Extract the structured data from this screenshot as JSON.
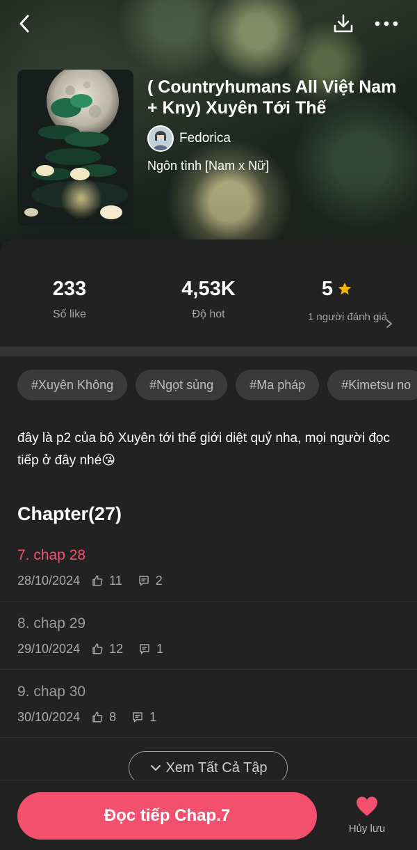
{
  "header": {
    "title": "( Countryhumans All Việt Nam + Kny) Xuyên Tới Thế",
    "author": "Fedorica",
    "genre": "Ngôn tình [Nam x Nữ]"
  },
  "stats": {
    "likes": {
      "value": "233",
      "label": "Số like"
    },
    "hot": {
      "value": "4,53K",
      "label": "Độ hot"
    },
    "rating": {
      "value": "5",
      "label": "1 người đánh giá"
    }
  },
  "tags": [
    "#Xuyên Không",
    "#Ngọt sủng",
    "#Ma pháp",
    "#Kimetsu no"
  ],
  "description": "đây là p2 của bộ Xuyên tới thế giới diệt quỷ nha, mọi người đọc tiếp ở đây nhé😘",
  "chapters": {
    "heading": "Chapter(27)",
    "items": [
      {
        "title": "7. chap 28",
        "date": "28/10/2024",
        "likes": "11",
        "comments": "2"
      },
      {
        "title": "8. chap 29",
        "date": "29/10/2024",
        "likes": "12",
        "comments": "1"
      },
      {
        "title": "9. chap 30",
        "date": "30/10/2024",
        "likes": "8",
        "comments": "1"
      }
    ],
    "see_all": "Xem Tất Cả Tập"
  },
  "bottom": {
    "read_button": "Đọc tiếp Chap.7",
    "save_label": "Hủy lưu"
  },
  "colors": {
    "accent": "#f2506c",
    "background": "#222222",
    "star": "#f5b400"
  },
  "icons": {
    "back": "chevron-left-icon",
    "download": "download-icon",
    "more": "more-horizontal-icon",
    "star": "star-icon",
    "like": "thumbs-up-icon",
    "comment": "comment-icon",
    "chevron_down": "chevron-down-icon",
    "heart": "heart-icon"
  }
}
